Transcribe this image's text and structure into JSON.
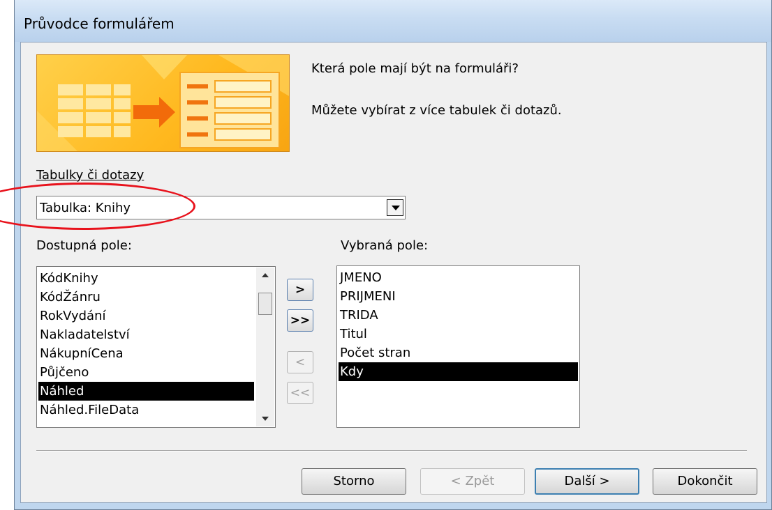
{
  "window": {
    "title": "Průvodce formulářem"
  },
  "intro": {
    "question": "Která pole mají být na formuláři?",
    "hint": "Můžete vybírat z více tabulek či dotazů."
  },
  "source": {
    "label": "Tabulky či dotazy",
    "selected": "Tabulka: Knihy"
  },
  "available": {
    "label": "Dostupná pole:",
    "items": [
      "KódKnihy",
      "KódŽánru",
      "RokVydání",
      "Nakladatelství",
      "NákupníCena",
      "Půjčeno",
      "Náhled",
      "Náhled.FileData"
    ],
    "selected": "Náhled"
  },
  "chosen": {
    "label": "Vybraná pole:",
    "items": [
      "JMENO",
      "PRIJMENI",
      "TRIDA",
      "Titul",
      "Počet stran",
      "Kdy"
    ],
    "selected": "Kdy"
  },
  "move_buttons": {
    "add_one": ">",
    "add_all": ">>",
    "remove_one": "<",
    "remove_all": "<<"
  },
  "footer": {
    "cancel": "Storno",
    "back": "< Zpět",
    "next": "Další >",
    "finish": "Dokončit"
  },
  "colors": {
    "banner": "#ffc02a",
    "selection": "#000000",
    "annotation": "#e8121c"
  }
}
